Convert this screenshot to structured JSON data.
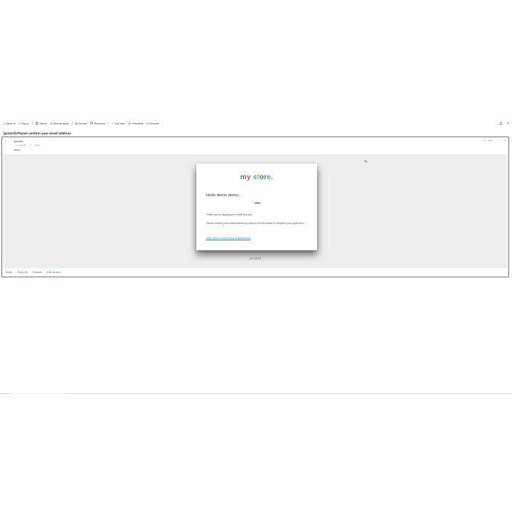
{
  "toolbar": {
    "items": [
      {
        "icon": "folder-icon",
        "label": "Move to"
      },
      {
        "icon": "tag-icon",
        "label": "Tag as"
      },
      {
        "icon": "trash-icon",
        "label": "Delete"
      },
      {
        "icon": "spam-icon",
        "label": "Mark as spam"
      },
      {
        "icon": "archive-icon",
        "label": "Archive"
      },
      {
        "icon": "reminder-icon",
        "label": "Reminder"
      },
      {
        "icon": "check-icon",
        "label": "Add task"
      },
      {
        "icon": "link-icon",
        "label": "Permalink"
      },
      {
        "icon": "more-icon",
        "label": "Recover"
      }
    ],
    "more": "›",
    "print_icon": "printer-icon",
    "close_icon": "close-icon"
  },
  "message": {
    "subject": "[prezisf] Please confirm your email address",
    "sender": "prezisf",
    "meta_time": "1:15 AM",
    "meta_folder": "Inbox",
    "to": "demo",
    "actions": [
      "↰",
      "↰↰",
      "→",
      "⋮",
      "×"
    ]
  },
  "email": {
    "logo_parts": [
      {
        "text": "m",
        "color": "#3b7bbf"
      },
      {
        "text": "y",
        "color": "#e8463c"
      },
      {
        "text": " ",
        "color": "#ffffff"
      },
      {
        "text": "s",
        "color": "#2fa8c8"
      },
      {
        "text": "t",
        "color": "#f0a324"
      },
      {
        "text": "o",
        "color": "#7a56b0"
      },
      {
        "text": "r",
        "color": "#3b7bbf"
      },
      {
        "text": "e",
        "color": "#4caf50"
      },
      {
        "text": ".",
        "color": "#e8463c"
      }
    ],
    "greeting": "Hello demo demo,",
    "paragraph1": "Thank you for applying for a B2B Account.",
    "paragraph2": "Please confirm your email address by clicking the link below to complete your application.",
    "link_text": "Click here to confirm your email address",
    "footer_brand": "prezisf"
  },
  "reply_bar": {
    "reply": "Reply",
    "reply_all": "Reply All",
    "forward": "Forward",
    "edit_as_new": "Edit as new",
    "separator": "•"
  }
}
